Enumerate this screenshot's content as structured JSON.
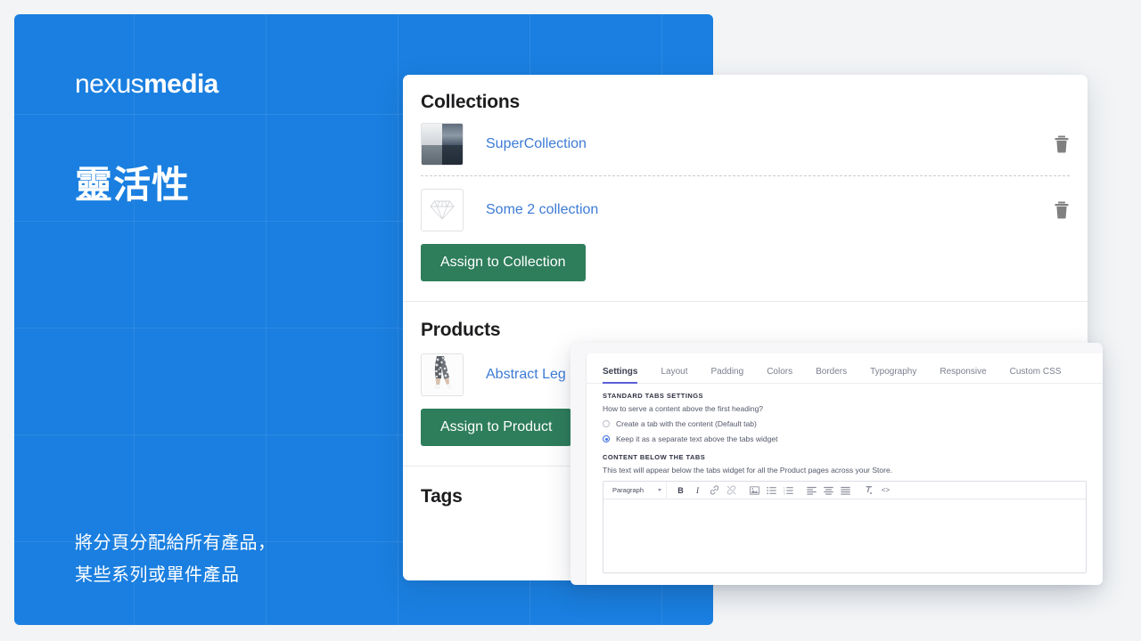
{
  "promo": {
    "logo_light": "nexus",
    "logo_bold": "media",
    "headline": "靈活性",
    "subtext": "將分頁分配給所有產品，\n某些系列或單件產品",
    "background_color": "#1a7fe0"
  },
  "card": {
    "collections": {
      "title": "Collections",
      "items": [
        {
          "label": "SuperCollection",
          "thumbnail": "seascape-photo",
          "delete_icon": "trash-icon"
        },
        {
          "label": "Some 2 collection",
          "thumbnail": "diamond-outline",
          "delete_icon": "trash-icon"
        }
      ],
      "assign_button": "Assign to Collection"
    },
    "products": {
      "title": "Products",
      "items": [
        {
          "label": "Abstract Leg",
          "thumbnail": "leggings-photo"
        }
      ],
      "assign_button": "Assign to Product"
    },
    "tags": {
      "title": "Tags"
    }
  },
  "settings": {
    "tabs": [
      {
        "label": "Settings",
        "active": true
      },
      {
        "label": "Layout",
        "active": false
      },
      {
        "label": "Padding",
        "active": false
      },
      {
        "label": "Colors",
        "active": false
      },
      {
        "label": "Borders",
        "active": false
      },
      {
        "label": "Typography",
        "active": false
      },
      {
        "label": "Responsive",
        "active": false
      },
      {
        "label": "Custom CSS",
        "active": false
      }
    ],
    "standard_tabs_caption": "STANDARD TABS SETTINGS",
    "standard_tabs_question": "How to serve a content above the first heading?",
    "radio_options": [
      {
        "label": "Create a tab with the content (Default tab)",
        "selected": false
      },
      {
        "label": "Keep it as a separate text above the tabs widget",
        "selected": true
      }
    ],
    "content_caption": "CONTENT BELOW THE TABS",
    "content_desc": "This text will appear below the tabs widget for all the Product pages across your Store.",
    "editor": {
      "format_select": "Paragraph",
      "toolbar_icons": [
        "bold-icon",
        "italic-icon",
        "link-icon",
        "unlink-icon",
        "image-icon",
        "bullet-list-icon",
        "numbered-list-icon",
        "align-left-icon",
        "align-center-icon",
        "align-justify-icon",
        "clear-format-icon",
        "source-code-icon"
      ],
      "content": ""
    },
    "accent_color": "#5b5fd6"
  },
  "theme": {
    "page_background": "#f2f4f6",
    "link_color": "#3d7bd6",
    "button_color": "#2e7d5b"
  }
}
